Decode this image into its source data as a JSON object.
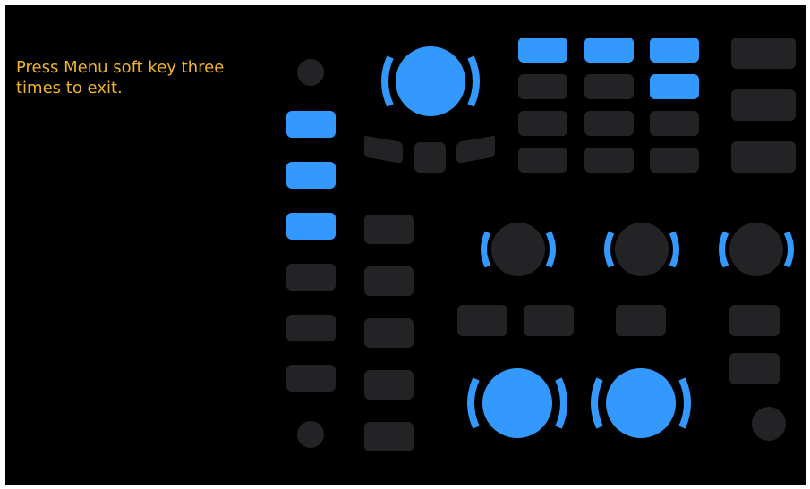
{
  "instruction": "Press Menu soft key three times to exit.",
  "colors": {
    "panel": "#000000",
    "key_active": "#3399ff",
    "key_idle": "#232326",
    "text": "#f0b429"
  },
  "left_column": {
    "keys_active": [
      true,
      true,
      true,
      false,
      false,
      false
    ]
  },
  "grid": {
    "rows": [
      [
        true,
        true,
        true
      ],
      [
        false,
        false,
        true
      ],
      [
        false,
        false,
        false
      ],
      [
        false,
        false,
        false
      ]
    ]
  },
  "knobs": {
    "top": "active",
    "mid_left": "idle",
    "mid_center": "idle",
    "mid_right": "idle",
    "bottom_left": "active",
    "bottom_right": "active"
  }
}
